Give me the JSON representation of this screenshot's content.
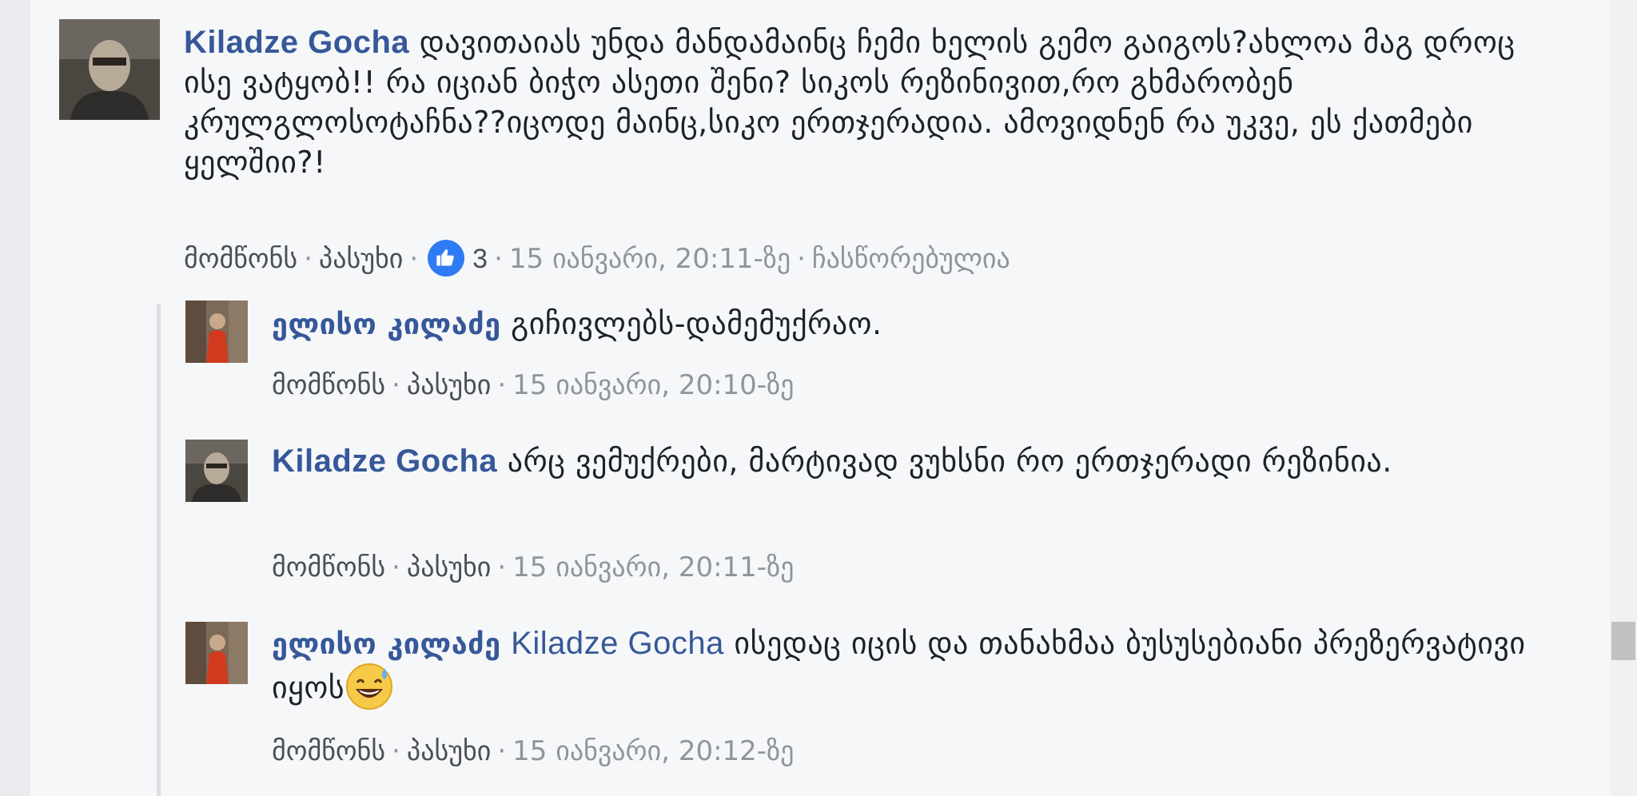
{
  "comments": [
    {
      "author": "Kiladze Gocha",
      "text": "დავითაიას უნდა მანდამაინც ჩემი ხელის გემო გაიგოს?ახლოა მაგ დროც ისე ვატყობ!! რა იციან ბიჭო ასეთი შენი? სიკოს რეზინივით,რო გხმარობენ კრულგლოსოტაჩნა??იცოდე მაინც,სიკო ერთჯერადია. ამოვიდნენ რა უკვე, ეს ქათმები ყელშიი?!",
      "like_label": "მომწონს",
      "reply_label": "პასუხი",
      "reactions": "3",
      "timestamp": "15 იანვარი, 20:11-ზე",
      "edited": "ჩასწორებულია"
    },
    {
      "author": "ელისო კილაძე",
      "text": "გიჩივლებს-დამემუქრაო.",
      "like_label": "მომწონს",
      "reply_label": "პასუხი",
      "timestamp": "15 იანვარი, 20:10-ზე"
    },
    {
      "author": "Kiladze Gocha",
      "text": "არც ვემუქრები, მარტივად ვუხსნი რო ერთჯერადი რეზინია.",
      "like_label": "მომწონს",
      "reply_label": "პასუხი",
      "timestamp": "15 იანვარი, 20:11-ზე"
    },
    {
      "author": "ელისო კილაძე",
      "mention": "Kiladze Gocha",
      "text": "ისედაც იცის და თანახმაა ბუსუსებიანი პრეზერვატივი იყოს",
      "emoji": "grinning-sweat-emoji",
      "like_label": "მომწონს",
      "reply_label": "პასუხი",
      "timestamp": "15 იანვარი, 20:12-ზე"
    }
  ],
  "separator": "·",
  "colors": {
    "author": "#365899",
    "meta": "#90949c",
    "like_badge": "#2f7bf5",
    "background": "#f6f7f9"
  }
}
